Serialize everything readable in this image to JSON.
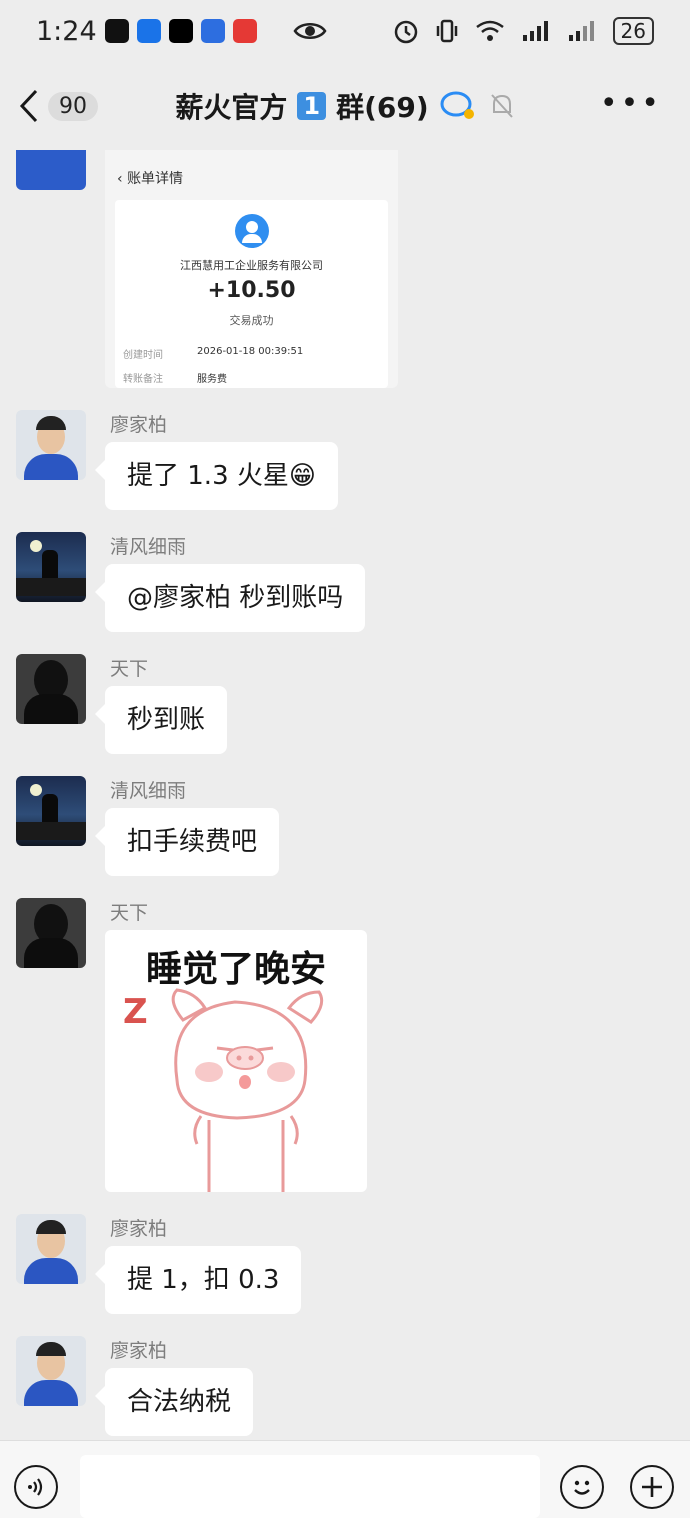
{
  "status": {
    "time": "1:24",
    "battery": "26"
  },
  "topbar": {
    "unread_count": "90",
    "title_prefix": "薪火官方",
    "title_num": "1",
    "title_suffix": "群(69)"
  },
  "receipt": {
    "header": "账单详情",
    "company": "江西慧用工企业服务有限公司",
    "amount": "+10.50",
    "status": "交易成功",
    "time_label": "创建时间",
    "time_value": "2026-01-18 00:39:51",
    "note_label": "转账备注",
    "note_value": "服务费"
  },
  "messages": [
    {
      "name": "廖家柏",
      "text": "提了 1.3 火星😁"
    },
    {
      "name": "清风细雨",
      "text": "@廖家柏  秒到账吗"
    },
    {
      "name": "天下",
      "text": "秒到账"
    },
    {
      "name": "清风细雨",
      "text": "扣手续费吧"
    },
    {
      "name": "天下",
      "sticker_text": "睡觉了晚安",
      "sticker_z": "Z"
    },
    {
      "name": "廖家柏",
      "text": "提 1，扣 0.3"
    },
    {
      "name": "廖家柏",
      "text": "合法纳税"
    }
  ]
}
